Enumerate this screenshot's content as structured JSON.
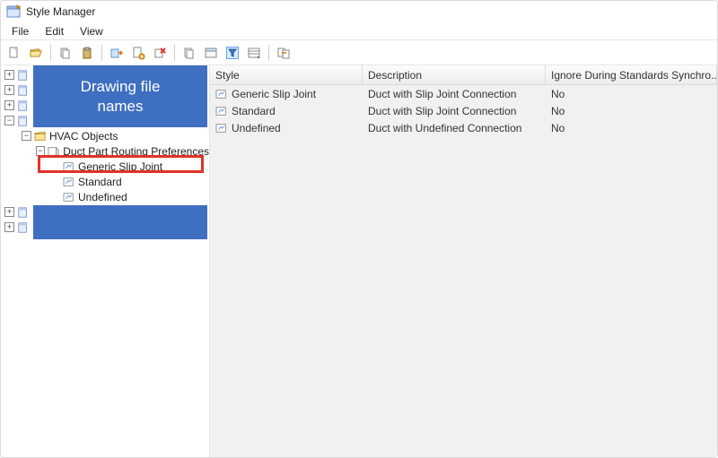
{
  "window": {
    "title": "Style Manager"
  },
  "menu": {
    "file": "File",
    "edit": "Edit",
    "view": "View"
  },
  "annotation": {
    "drawing_files": "Drawing file\nnames"
  },
  "tree": {
    "hvac_label": "HVAC Objects",
    "ductprefs_label": "Duct Part Routing Preferences",
    "items": [
      {
        "label": "Generic Slip Joint"
      },
      {
        "label": "Standard"
      },
      {
        "label": "Undefined"
      }
    ]
  },
  "grid": {
    "headers": {
      "style": "Style",
      "description": "Description",
      "ignore": "Ignore During Standards Synchro..."
    },
    "rows": [
      {
        "style": "Generic Slip Joint",
        "description": "Duct with Slip Joint Connection",
        "ignore": "No"
      },
      {
        "style": "Standard",
        "description": "Duct with Slip Joint Connection",
        "ignore": "No"
      },
      {
        "style": "Undefined",
        "description": "Duct with Undefined Connection",
        "ignore": "No"
      }
    ]
  }
}
